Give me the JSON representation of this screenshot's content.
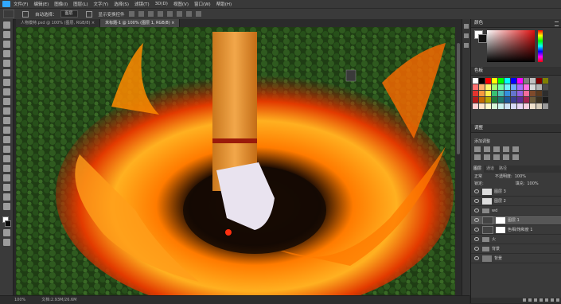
{
  "menubar": {
    "items": [
      "文件(F)",
      "编辑(E)",
      "图像(I)",
      "图层(L)",
      "文字(Y)",
      "选择(S)",
      "滤镜(T)",
      "3D(D)",
      "视图(V)",
      "窗口(W)",
      "帮助(H)"
    ]
  },
  "options": {
    "auto_select_label": "自动选择：",
    "auto_select_value": "图层",
    "show_transform_label": "显示变换控件"
  },
  "tabs": [
    {
      "label": "人物模特.psd @ 100% (图层, RGB/8) ×"
    },
    {
      "label": "未标题-1 @ 100% (图层 1, RGB/8) ×"
    }
  ],
  "status": {
    "zoom": "100%",
    "doc": "文档:2.93M/26.6M"
  },
  "panels": {
    "color_title": "颜色",
    "swatches_title": "色板",
    "adjustments_title": "调整",
    "adjustments_sub": "添加调整",
    "layers_tab": "图层",
    "channels_tab": "通道",
    "paths_tab": "路径",
    "blend_mode": "正常",
    "opacity_label": "不透明度:",
    "opacity_value": "100%",
    "lock_label": "锁定:",
    "fill_label": "填充:",
    "fill_value": "100%"
  },
  "layers": [
    {
      "name": "图层 3",
      "type": "normal"
    },
    {
      "name": "图层 2",
      "type": "normal"
    },
    {
      "name": "wd",
      "type": "group"
    },
    {
      "name": "图层 1",
      "type": "masked",
      "selected": true
    },
    {
      "name": "色相/饱和度 1",
      "type": "adjust"
    },
    {
      "name": "火",
      "type": "group"
    },
    {
      "name": "背景",
      "type": "group"
    },
    {
      "name": "背景",
      "type": "background"
    }
  ],
  "swatch_colors": [
    "#ffffff",
    "#000000",
    "#ff0000",
    "#ffff00",
    "#00ff00",
    "#00ffff",
    "#0000ff",
    "#ff00ff",
    "#808080",
    "#c0c0c0",
    "#800000",
    "#808000",
    "#ff6f6f",
    "#ffb36f",
    "#fff36f",
    "#a8ff6f",
    "#6fffa8",
    "#6ff3ff",
    "#6fa8ff",
    "#a86fff",
    "#ff6fe0",
    "#d9d9d9",
    "#b3b3b3",
    "#4d4d4d",
    "#e3342f",
    "#f6993f",
    "#ffed4a",
    "#38c172",
    "#4dc0b5",
    "#3490dc",
    "#6574cd",
    "#9561e2",
    "#f66d9b",
    "#7f4a2b",
    "#5a3a1f",
    "#2d2d2d",
    "#b31b1b",
    "#c46a00",
    "#b8a800",
    "#1f7a3a",
    "#1c7a72",
    "#1e5a99",
    "#3a3f8f",
    "#5e2e94",
    "#a3244f",
    "#6b5a3a",
    "#3a3020",
    "#1a1a1a",
    "#ffd0d0",
    "#ffe6cc",
    "#fffacc",
    "#d6f5d6",
    "#ccf2ef",
    "#cce3f7",
    "#d6d9f5",
    "#e6d6f5",
    "#f7d1e0",
    "#eee0cc",
    "#d6cbb8",
    "#999999"
  ],
  "colors": {
    "accent": "#31a8ff",
    "panel_bg": "#3a3a3a",
    "app_bg": "#282828"
  }
}
